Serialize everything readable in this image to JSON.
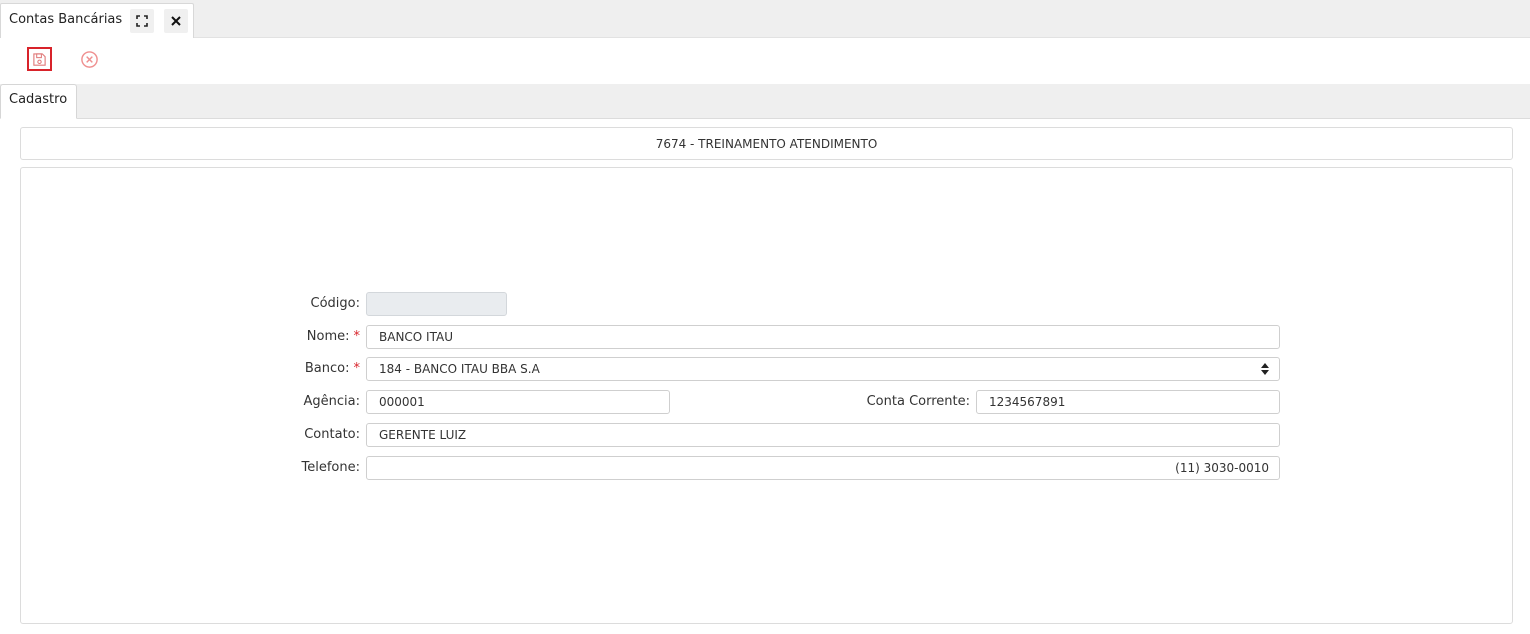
{
  "window": {
    "tab_title": "Contas Bancárias",
    "icons": {
      "maximize": "expand-icon",
      "close": "close-icon"
    }
  },
  "toolbar": {
    "save_icon": "floppy-disk-icon",
    "cancel_icon": "circle-x-icon",
    "accent_color": "#d8232a"
  },
  "tabs": [
    {
      "label": "Cadastro",
      "active": true
    }
  ],
  "company": {
    "label": "7674 - TREINAMENTO ATENDIMENTO"
  },
  "form": {
    "codigo": {
      "label": "Código:",
      "value": ""
    },
    "nome": {
      "label": "Nome:",
      "required_mark": "*",
      "value": "BANCO ITAU"
    },
    "banco": {
      "label": "Banco:",
      "required_mark": "*",
      "value": "184 - BANCO ITAU BBA S.A"
    },
    "agencia": {
      "label": "Agência:",
      "value": "000001"
    },
    "conta_corrente": {
      "label": "Conta Corrente:",
      "value": "1234567891"
    },
    "contato": {
      "label": "Contato:",
      "value": "GERENTE LUIZ"
    },
    "telefone": {
      "label": "Telefone:",
      "value": "(11) 3030-0010"
    }
  }
}
